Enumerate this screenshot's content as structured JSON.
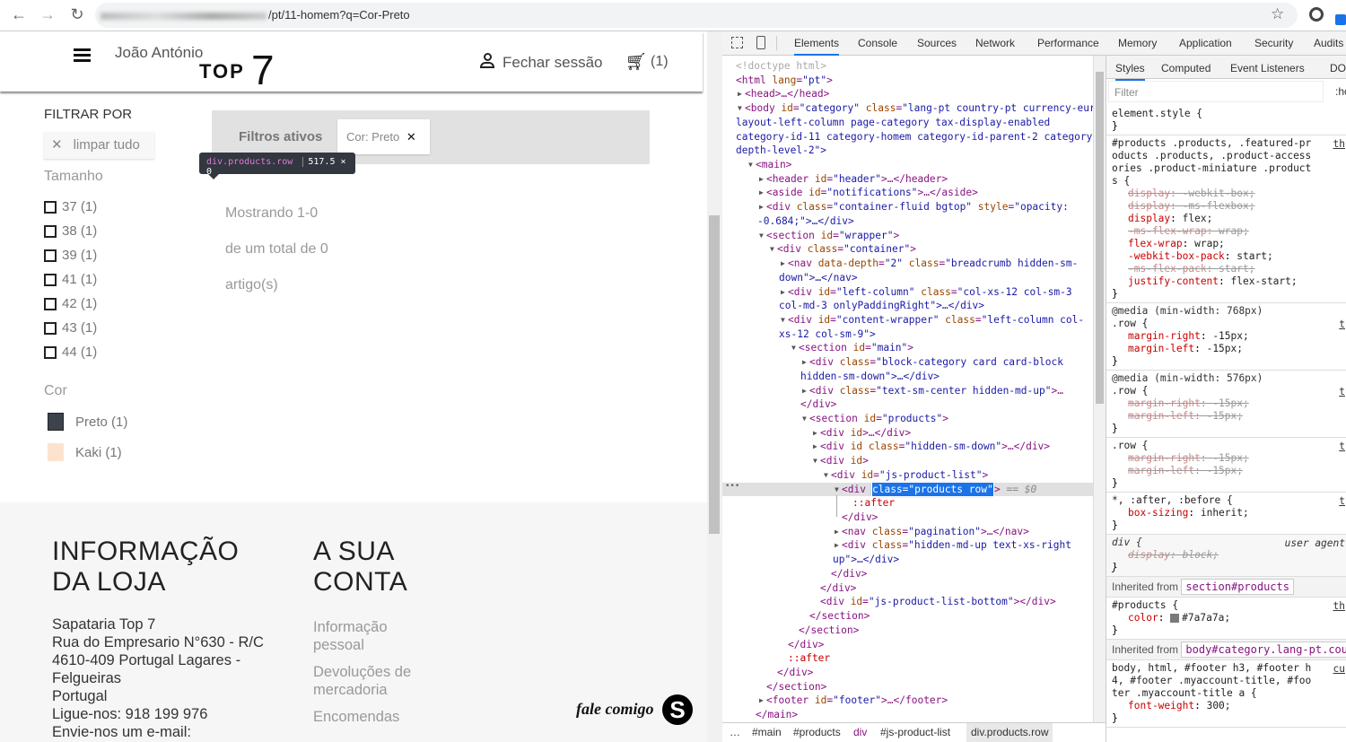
{
  "browser": {
    "url_visible": "/pt/11-homem?q=Cor-Preto",
    "back": "←",
    "forward": "→",
    "reload": "↻",
    "star": "☆"
  },
  "page": {
    "header": {
      "user_name": "João António",
      "logo_top": "TOP",
      "logo_num": "7",
      "logout": "Fechar sessão",
      "cart_count": "(1)"
    },
    "filters": {
      "title": "FILTRAR POR",
      "clear_all": "limpar tudo",
      "size_title": "Tamanho",
      "sizes": [
        {
          "label": "37 (1)"
        },
        {
          "label": "38 (1)"
        },
        {
          "label": "39 (1)"
        },
        {
          "label": "41 (1)"
        },
        {
          "label": "42 (1)"
        },
        {
          "label": "43 (1)"
        },
        {
          "label": "44 (1)"
        }
      ],
      "color_title": "Cor",
      "colors": [
        {
          "label": "Preto (1)",
          "swatch": "#3d434b"
        },
        {
          "label": "Kaki (1)",
          "swatch": "#fde3ce"
        }
      ]
    },
    "active_filters": {
      "title": "Filtros ativos",
      "chip": "Cor: Preto"
    },
    "tooltip": {
      "selector": "div.products.row",
      "size": "517.5 × 0"
    },
    "results": {
      "line1": "Mostrando 1-0",
      "line2": "de um total de 0",
      "line3": "artigo(s)"
    },
    "footer": {
      "store_title_1": "INFORMAÇÃO",
      "store_title_2": "DA LOJA",
      "address": [
        "Sapataria Top 7",
        "Rua do Empresario N°630 - R/C",
        "4610-409 Portugal Lagares -",
        "Felgueiras",
        "Portugal",
        "Ligue-nos: 918 199 976",
        "Envie-nos um e-mail:"
      ],
      "account_title_1": "A SUA",
      "account_title_2": "CONTA",
      "account_links": [
        {
          "l1": "Informação",
          "l2": "pessoal"
        },
        {
          "l1": "Devoluções de",
          "l2": "mercadoria"
        },
        {
          "l1": "Encomendas",
          "l2": ""
        }
      ],
      "chat_label": "fale comigo"
    }
  },
  "devtools": {
    "tabs": [
      "Elements",
      "Console",
      "Sources",
      "Network",
      "Performance",
      "Memory",
      "Application",
      "Security",
      "Audits"
    ],
    "active_tab": "Elements",
    "dom": [
      {
        "depth": 0,
        "kind": "flat",
        "text": "<!doctype html>"
      },
      {
        "depth": 0,
        "kind": "flat",
        "text": "<html lang=\"pt\">"
      },
      {
        "depth": 0,
        "kind": "arrow",
        "arrow": "▶",
        "text": "<head>…</head>"
      },
      {
        "depth": 0,
        "kind": "arrow",
        "arrow": "▼",
        "text": "<body id=\"category\" class=\"lang-pt country-pt currency-eur"
      },
      {
        "depth": 0,
        "kind": "flat",
        "text": "layout-left-column page-category tax-display-enabled"
      },
      {
        "depth": 0,
        "kind": "flat",
        "text": "category-id-11 category-homem category-id-parent-2 category-"
      },
      {
        "depth": 0,
        "kind": "flat",
        "text": "depth-level-2\">"
      },
      {
        "depth": 1,
        "kind": "arrow",
        "arrow": "▼",
        "text": "<main>"
      },
      {
        "depth": 2,
        "kind": "arrow",
        "arrow": "▶",
        "text": "<header id=\"header\">…</header>"
      },
      {
        "depth": 2,
        "kind": "arrow",
        "arrow": "▶",
        "text": "<aside id=\"notifications\">…</aside>"
      },
      {
        "depth": 2,
        "kind": "arrow",
        "arrow": "▶",
        "text": "<div class=\"container-fluid bgtop\" style=\"opacity:"
      },
      {
        "depth": 2,
        "kind": "flat",
        "text": "-0.684;\">…</div>"
      },
      {
        "depth": 2,
        "kind": "arrow",
        "arrow": "▼",
        "text": "<section id=\"wrapper\">"
      },
      {
        "depth": 3,
        "kind": "arrow",
        "arrow": "▼",
        "text": "<div class=\"container\">"
      },
      {
        "depth": 4,
        "kind": "arrow",
        "arrow": "▶",
        "text": "<nav data-depth=\"2\" class=\"breadcrumb hidden-sm-"
      },
      {
        "depth": 4,
        "kind": "flat",
        "text": "down\">…</nav>"
      },
      {
        "depth": 4,
        "kind": "arrow",
        "arrow": "▶",
        "text": "<div id=\"left-column\" class=\"col-xs-12 col-sm-3"
      },
      {
        "depth": 4,
        "kind": "flat",
        "text": "col-md-3 onlyPaddingRight\">…</div>"
      },
      {
        "depth": 4,
        "kind": "arrow",
        "arrow": "▼",
        "text": "<div id=\"content-wrapper\" class=\"left-column col-"
      },
      {
        "depth": 4,
        "kind": "flat",
        "text": "xs-12 col-sm-9\">"
      },
      {
        "depth": 5,
        "kind": "arrow",
        "arrow": "▼",
        "text": "<section id=\"main\">"
      },
      {
        "depth": 6,
        "kind": "arrow",
        "arrow": "▶",
        "text": "<div class=\"block-category card card-block"
      },
      {
        "depth": 6,
        "kind": "flat",
        "text": "hidden-sm-down\">…</div>"
      },
      {
        "depth": 6,
        "kind": "arrow",
        "arrow": "▶",
        "text": "<div class=\"text-sm-center hidden-md-up\">…"
      },
      {
        "depth": 6,
        "kind": "flat",
        "text": "</div>"
      },
      {
        "depth": 6,
        "kind": "arrow",
        "arrow": "▼",
        "text": "<section id=\"products\">"
      },
      {
        "depth": 7,
        "kind": "arrow",
        "arrow": "▶",
        "text": "<div id>…</div>"
      },
      {
        "depth": 7,
        "kind": "arrow",
        "arrow": "▶",
        "text": "<div id class=\"hidden-sm-down\">…</div>"
      },
      {
        "depth": 7,
        "kind": "arrow",
        "arrow": "▼",
        "text": "<div id>"
      },
      {
        "depth": 8,
        "kind": "arrow",
        "arrow": "▼",
        "text": "<div id=\"js-product-list\">"
      },
      {
        "depth": 9,
        "kind": "arrow",
        "arrow": "▼",
        "text": "<div ",
        "highlight": "class=\"products row\"",
        "after": ">",
        "marker": " == $0",
        "selected": true,
        "gutter": "•••"
      },
      {
        "depth": 10,
        "kind": "plain",
        "text": "::after",
        "pseudo": true
      },
      {
        "depth": 9,
        "kind": "plain",
        "text": "</div>"
      },
      {
        "depth": 9,
        "kind": "arrow",
        "arrow": "▶",
        "text": "<nav class=\"pagination\">…</nav>"
      },
      {
        "depth": 9,
        "kind": "arrow",
        "arrow": "▶",
        "text": "<div class=\"hidden-md-up text-xs-right"
      },
      {
        "depth": 9,
        "kind": "flat",
        "text": "up\">…</div>"
      },
      {
        "depth": 8,
        "kind": "plain",
        "text": "</div>"
      },
      {
        "depth": 7,
        "kind": "plain",
        "text": "</div>"
      },
      {
        "depth": 7,
        "kind": "plain",
        "text": "<div id=\"js-product-list-bottom\"></div>"
      },
      {
        "depth": 6,
        "kind": "plain",
        "text": "</section>"
      },
      {
        "depth": 5,
        "kind": "plain",
        "text": "</section>"
      },
      {
        "depth": 4,
        "kind": "plain",
        "text": "</div>"
      },
      {
        "depth": 4,
        "kind": "plain",
        "text": "::after",
        "pseudo": true
      },
      {
        "depth": 3,
        "kind": "plain",
        "text": "</div>"
      },
      {
        "depth": 2,
        "kind": "plain",
        "text": "</section>"
      },
      {
        "depth": 2,
        "kind": "arrow",
        "arrow": "▶",
        "text": "<footer id=\"footer\">…</footer>"
      },
      {
        "depth": 1,
        "kind": "plain",
        "text": "</main>"
      }
    ],
    "breadcrumbs": [
      "…",
      "#main",
      "#products",
      "div",
      "#js-product-list",
      "div.products.row"
    ],
    "styles": {
      "tabs": [
        "Styles",
        "Computed",
        "Event Listeners",
        "DOM"
      ],
      "filter_placeholder": "Filter",
      "hov": ":ho",
      "rules": [
        {
          "selector": "element.style {",
          "props": []
        },
        {
          "selector": "#products .products, .featured-products .products, .product-accessories .product-miniature .products {",
          "source": "th",
          "props": [
            {
              "name": "display",
              "value": "-webkit-box;",
              "struck": true
            },
            {
              "name": "display",
              "value": "-ms-flexbox;",
              "struck": true
            },
            {
              "name": "display",
              "value": "flex;"
            },
            {
              "name": "-ms-flex-wrap",
              "value": "wrap;",
              "struck": true
            },
            {
              "name": "flex-wrap",
              "value": "wrap;"
            },
            {
              "name": "-webkit-box-pack",
              "value": "start;"
            },
            {
              "name": "-ms-flex-pack",
              "value": "start;",
              "struck": true
            },
            {
              "name": "justify-content",
              "value": "flex-start;"
            }
          ]
        },
        {
          "media": "@media (min-width: 768px)",
          "selector": ".row {",
          "source": "t",
          "props": [
            {
              "name": "margin-right",
              "value": "-15px;"
            },
            {
              "name": "margin-left",
              "value": "-15px;"
            }
          ]
        },
        {
          "media": "@media (min-width: 576px)",
          "selector": ".row {",
          "source": "t",
          "props": [
            {
              "name": "margin-right",
              "value": "-15px;",
              "struck": true
            },
            {
              "name": "margin-left",
              "value": "-15px;",
              "struck": true
            }
          ]
        },
        {
          "selector": ".row {",
          "source": "t",
          "props": [
            {
              "name": "margin-right",
              "value": "-15px;",
              "struck": true
            },
            {
              "name": "margin-left",
              "value": "-15px;",
              "struck": true
            }
          ]
        },
        {
          "selector": "*, :after, :before {",
          "source": "t",
          "props": [
            {
              "name": "box-sizing",
              "value": "inherit;"
            }
          ]
        },
        {
          "selector": "div {",
          "source": "user agent",
          "ua": true,
          "props": [
            {
              "name": "display",
              "value": "block;",
              "struck": true
            }
          ]
        },
        {
          "inherited": "Inherited from",
          "node": "section#products"
        },
        {
          "selector": "#products {",
          "source": "th",
          "props": [
            {
              "name": "color",
              "value": "#7a7a7a;",
              "swatch": "#7a7a7a"
            }
          ]
        },
        {
          "inherited": "Inherited from",
          "node": "body#category.lang-pt.country-pt"
        },
        {
          "selector": "body, html, #footer h3, #footer h4, #footer .myaccount-title, #footer .myaccount-title a {",
          "source": "cu",
          "props": [
            {
              "name": "font-weight",
              "value": "300;"
            }
          ]
        }
      ]
    }
  }
}
